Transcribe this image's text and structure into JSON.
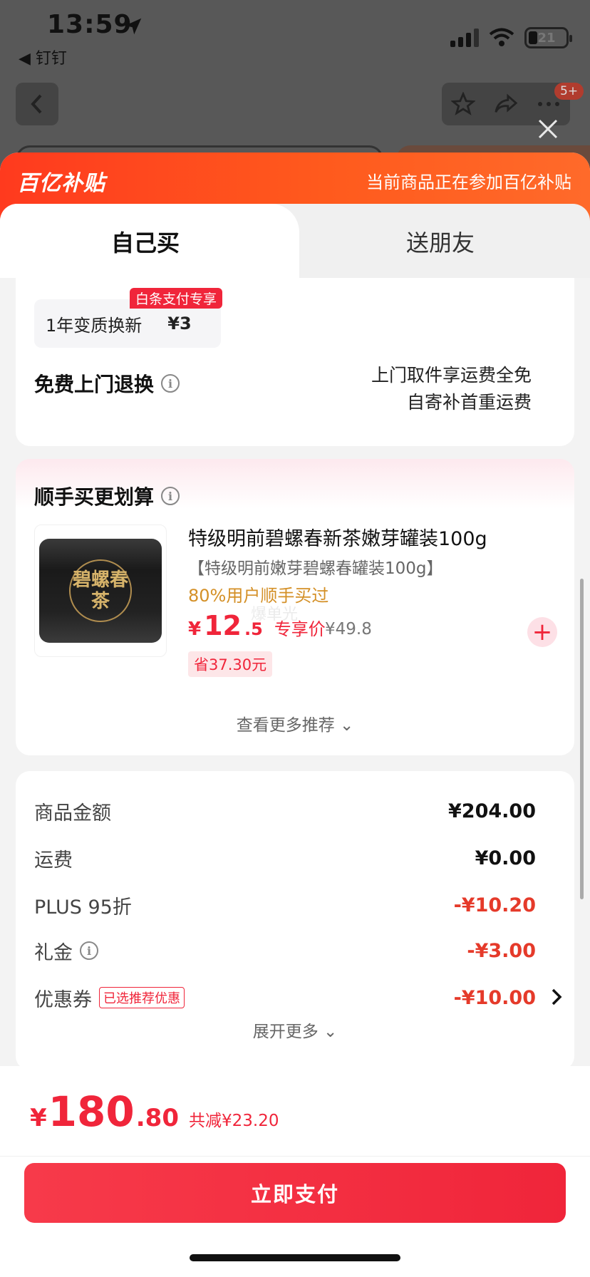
{
  "status_bar": {
    "time": "13:59",
    "back_app": "◀ 钉钉",
    "battery": "21"
  },
  "nav": {
    "badge": "5+"
  },
  "promo": {
    "logo": "百亿补贴",
    "text": "当前商品正在参加百亿补贴"
  },
  "tabs": [
    {
      "label": "自己买",
      "active": true
    },
    {
      "label": "送朋友",
      "active": false
    }
  ],
  "service": {
    "name": "1年变质换新",
    "price": "¥3",
    "tag": "白条支付专享",
    "return_title": "免费上门退换",
    "return_lines": [
      "上门取件享运费全免",
      "自寄补首重运费"
    ]
  },
  "combo": {
    "title": "顺手买更划算",
    "product": {
      "image_text": "碧螺春茶",
      "name": "特级明前碧螺春新茶嫩芽罐装100g",
      "sub": "【特级明前嫩芽碧螺春罐装100g】",
      "rate": "80%用户顺手买过",
      "price_symbol": "¥",
      "price_int": "12",
      "price_dec": ".5",
      "price_label": "专享价",
      "orig_price": "¥49.8",
      "save": "省37.30元",
      "add": "+"
    },
    "watermark": "爆单光",
    "more": "查看更多推荐 ⌄"
  },
  "fees": {
    "rows": [
      {
        "label": "商品金额",
        "value": "¥204.00",
        "red": false
      },
      {
        "label": "运费",
        "value": "¥0.00",
        "red": false
      },
      {
        "label": "PLUS 95折",
        "value": "-¥10.20",
        "red": true
      },
      {
        "label": "礼金",
        "value": "-¥3.00",
        "red": true
      },
      {
        "label": "优惠券",
        "value": "-¥10.00",
        "red": true,
        "tag": "已选推荐优惠"
      }
    ],
    "expand": "展开更多 ⌄"
  },
  "checkout": {
    "symbol": "¥",
    "total_int": "180",
    "total_dec": ".80",
    "reduced": "共减¥23.20",
    "pay_label": "立即支付"
  },
  "colors": {
    "accent": "#f0253a",
    "promo": "#ff4a1e",
    "orange_text": "#d49027"
  }
}
